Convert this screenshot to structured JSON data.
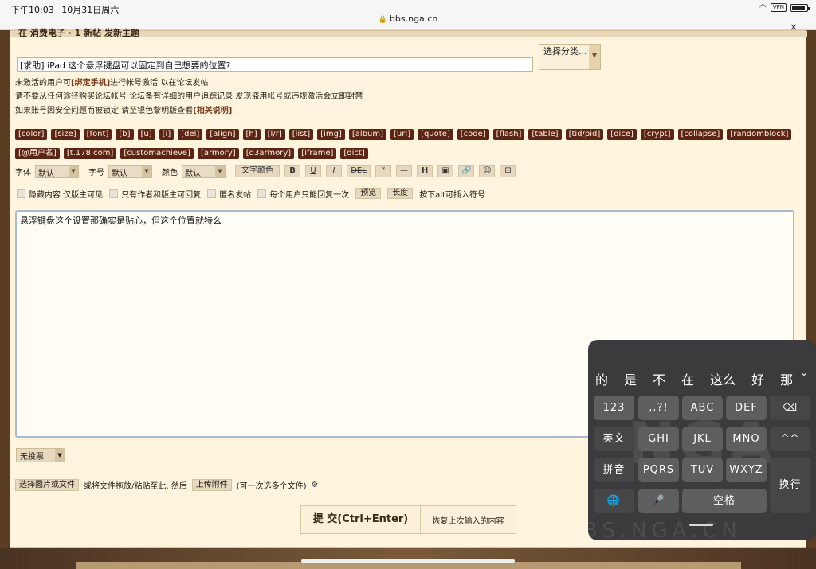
{
  "status_bar": {
    "time": "下午10:03",
    "date": "10月31日周六",
    "url": "bbs.nga.cn",
    "vpn": "VPN"
  },
  "panel": {
    "top_title": "在 消费电子 · 1 新帖 发新主题",
    "close": "×"
  },
  "title_input": {
    "value": "[求助] iPad 这个悬浮键盘可以固定到自己想要的位置?"
  },
  "category_select": {
    "label": "选择分类..."
  },
  "notices": [
    {
      "pre": "未激活的用户可",
      "link": "[绑定手机]",
      "post": "进行帐号激活 以在论坛发帖"
    },
    {
      "pre": "请不要从任何途径购买论坛帐号 论坛备有详细的用户追踪记录 发现盗用帐号或违规激活会立即封禁",
      "link": "",
      "post": ""
    },
    {
      "pre": "如果账号因安全问题而被锁定 请至银色黎明版查看",
      "link": "[相关说明]",
      "post": ""
    }
  ],
  "tags": [
    "[color]",
    "[size]",
    "[font]",
    "[b]",
    "[u]",
    "[i]",
    "[del]",
    "[align]",
    "[h]",
    "[l/r]",
    "[list]",
    "[img]",
    "[album]",
    "[url]",
    "[quote]",
    "[code]",
    "[flash]",
    "[table]",
    "[tid/pid]",
    "[dice]",
    "[crypt]",
    "[collapse]",
    "[randomblock]",
    "[@用户名]",
    "[t.178.com]",
    "[customachieve]",
    "[armory]",
    "[d3armory]",
    "[iframe]",
    "[dict]"
  ],
  "toolbar": {
    "font_label": "字体",
    "font_value": "默认",
    "size_label": "字号",
    "size_value": "默认",
    "color_label": "颜色",
    "color_value": "默认",
    "text_color_btn": "文字颜色",
    "bold": "B",
    "underline": "U",
    "italic": "I",
    "del": "DEL",
    "quote": "“",
    "hr": "—",
    "heading": "H"
  },
  "options": {
    "hidden": "隐藏内容 仅版主可见",
    "author_only": "只有作者和版主可回复",
    "anonymous": "匿名发帖",
    "reply_once": "每个用户只能回复一次",
    "preview": "预览",
    "length": "长度",
    "alt_hint": "按下alt可插入符号"
  },
  "editor": {
    "text": "悬浮键盘这个设置那确实是贴心，但这个位置就特么"
  },
  "vote": {
    "value": "无投票"
  },
  "upload": {
    "select_btn": "选择图片或文件",
    "hint": "或将文件拖放/粘贴至此, 然后",
    "upload_btn": "上传附件",
    "multi_hint": "(可一次选多个文件)"
  },
  "submit": {
    "submit_label": "提 交(Ctrl+Enter)",
    "restore_label": "恢复上次输入的内容"
  },
  "keyboard": {
    "candidates": [
      "的",
      "是",
      "不",
      "在",
      "这么",
      "好",
      "那"
    ],
    "rows": [
      [
        "123",
        ",.?!",
        "ABC",
        "DEF",
        "⌫"
      ],
      [
        "英文",
        "GHI",
        "JKL",
        "MNO",
        "^^"
      ],
      [
        "拼音",
        "PQRS",
        "TUV",
        "WXYZ",
        "换行"
      ],
      [
        "🌐",
        "🎤",
        "空格"
      ]
    ],
    "watermark": "NGA",
    "watermark_url": "BBS.NGA.CN"
  }
}
